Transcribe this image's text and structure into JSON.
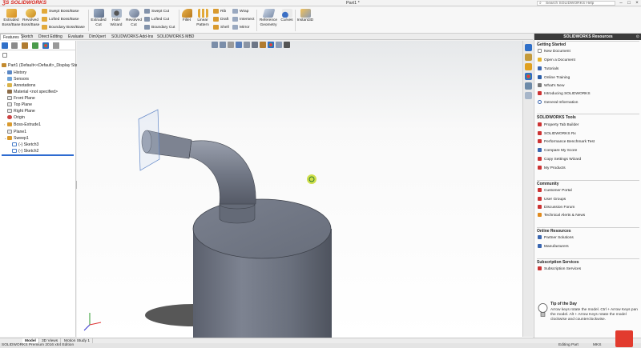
{
  "titlebar": {
    "logo": "SOLIDWORKS",
    "document": "Part1 *",
    "search_placeholder": "Search SOLIDWORKS Help",
    "controls": [
      "–",
      "□",
      "×"
    ]
  },
  "command_manager": {
    "features": [
      {
        "label": "Extruded Boss/Base",
        "icon": "extrude-boss-icon"
      },
      {
        "label": "Revolved Boss/Base",
        "icon": "revolve-boss-icon"
      }
    ],
    "boss_small": [
      "Swept Boss/Base",
      "Lofted Boss/Base",
      "Boundary Boss/Base"
    ],
    "cut_big": [
      {
        "label": "Extruded Cut",
        "icon": "extrude-cut-icon"
      },
      {
        "label": "Hole Wizard",
        "icon": "hole-wizard-icon"
      },
      {
        "label": "Revolved Cut",
        "icon": "revolve-cut-icon"
      }
    ],
    "cut_small": [
      "Swept Cut",
      "Lofted Cut",
      "Boundary Cut"
    ],
    "fillet": "Fillet",
    "linear_pattern": "Linear Pattern",
    "modify_small_a": [
      "Rib",
      "Draft",
      "Shell"
    ],
    "modify_small_b": [
      "Wrap",
      "Intersect",
      "Mirror"
    ],
    "reference_geometry": "Reference Geometry",
    "curves": "Curves",
    "instant3d": "Instant3D"
  },
  "tabs": [
    "Features",
    "Sketch",
    "Direct Editing",
    "Evaluate",
    "DimXpert",
    "SOLIDWORKS Add-Ins",
    "SOLIDWORKS MBD"
  ],
  "feature_tree": {
    "root": "Part1  (Default<<Default>_Display State",
    "items": [
      "History",
      "Sensors",
      "Annotations",
      "Material <not specified>",
      "Front Plane",
      "Top Plane",
      "Right Plane",
      "Origin",
      "Boss-Extrude1",
      "Plane1",
      "Sweep1",
      "(-) Sketch3",
      "(-) Sketch2"
    ]
  },
  "task_pane": {
    "title": "SOLIDWORKS Resources",
    "getting_started": {
      "title": "Getting Started",
      "items": [
        "New Document",
        "Open a Document",
        "Tutorials",
        "Online Training",
        "What's New",
        "Introducing SOLIDWORKS",
        "General Information"
      ]
    },
    "tools": {
      "title": "SOLIDWORKS Tools",
      "items": [
        "Property Tab Builder",
        "SOLIDWORKS Rx",
        "Performance Benchmark Test",
        "Compare My Score",
        "Copy Settings Wizard",
        "My Products"
      ]
    },
    "community": {
      "title": "Community",
      "items": [
        "Customer Portal",
        "User Groups",
        "Discussion Forum",
        "Technical Alerts & News"
      ]
    },
    "online": {
      "title": "Online Resources",
      "items": [
        "Partner Solutions",
        "Manufacturers"
      ]
    },
    "subscription": {
      "title": "Subscription Services",
      "items": [
        "Subscription Services"
      ]
    },
    "tip": {
      "title": "Tip of the Day",
      "text": "Arrow keys rotate the model. Ctrl + Arrow Keys pan the model. Alt + Arrow Keys rotate the model clockwise and counterclockwise."
    }
  },
  "bottom_tabs": [
    "Model",
    "3D Views",
    "Motion Study 1"
  ],
  "status": {
    "app": "SOLIDWORKS Premium 2016 x64 Edition",
    "mode": "Editing Part",
    "units": "MKS"
  },
  "colors": {
    "accent_red": "#d7261e",
    "rollback_blue": "#2e6bd1",
    "model_face": "#6f7584"
  }
}
